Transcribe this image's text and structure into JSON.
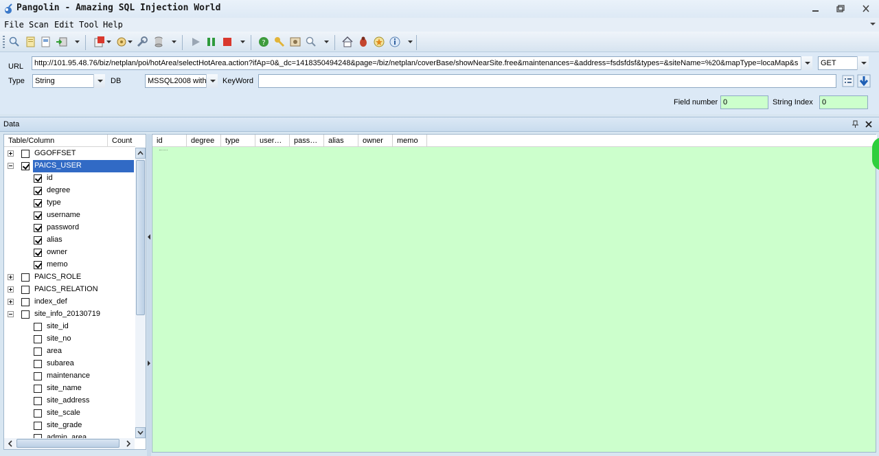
{
  "window": {
    "title": "Pangolin - Amazing SQL Injection World"
  },
  "menu": [
    "File",
    "Scan",
    "Edit",
    "Tool",
    "Help"
  ],
  "form": {
    "url_label": "URL",
    "url_value": "http://101.95.48.76/biz/netplan/poi/hotArea!selectHotArea.action?ifAp=0&_dc=1418350494248&page=/biz/netplan/coverBase/showNearSite.free&maintenances=&address=fsdsfdsf&types=&siteName=%20&mapType=locaMap&s",
    "method": "GET",
    "type_label": "Type",
    "type_value": "String",
    "db_label": "DB",
    "db_value": "MSSQL2008 with I",
    "keyword_label": "KeyWord",
    "keyword_value": "",
    "field_number_label": "Field number",
    "field_number_value": "0",
    "string_index_label": "String Index",
    "string_index_value": "0"
  },
  "panel": {
    "title": "Data"
  },
  "tree": {
    "col_table": "Table/Column",
    "col_count": "Count",
    "rows": [
      {
        "label": "GGOFFSET",
        "level": 0,
        "expander": "plus",
        "checked": false
      },
      {
        "label": "PAICS_USER",
        "level": 0,
        "expander": "minus",
        "checked": true,
        "selected": true
      },
      {
        "label": "id",
        "level": 1,
        "checked": true
      },
      {
        "label": "degree",
        "level": 1,
        "checked": true
      },
      {
        "label": "type",
        "level": 1,
        "checked": true
      },
      {
        "label": "username",
        "level": 1,
        "checked": true
      },
      {
        "label": "password",
        "level": 1,
        "checked": true
      },
      {
        "label": "alias",
        "level": 1,
        "checked": true
      },
      {
        "label": "owner",
        "level": 1,
        "checked": true
      },
      {
        "label": "memo",
        "level": 1,
        "checked": true
      },
      {
        "label": "PAICS_ROLE",
        "level": 0,
        "expander": "plus",
        "checked": false
      },
      {
        "label": "PAICS_RELATION",
        "level": 0,
        "expander": "plus",
        "checked": false
      },
      {
        "label": "index_def",
        "level": 0,
        "expander": "plus",
        "checked": false
      },
      {
        "label": "site_info_20130719",
        "level": 0,
        "expander": "minus",
        "checked": false
      },
      {
        "label": "site_id",
        "level": 1,
        "checked": false
      },
      {
        "label": "site_no",
        "level": 1,
        "checked": false
      },
      {
        "label": "area",
        "level": 1,
        "checked": false
      },
      {
        "label": "subarea",
        "level": 1,
        "checked": false
      },
      {
        "label": "maintenance",
        "level": 1,
        "checked": false
      },
      {
        "label": "site_name",
        "level": 1,
        "checked": false
      },
      {
        "label": "site_address",
        "level": 1,
        "checked": false
      },
      {
        "label": "site_scale",
        "level": 1,
        "checked": false
      },
      {
        "label": "site_grade",
        "level": 1,
        "checked": false
      },
      {
        "label": "admin_area",
        "level": 1,
        "checked": false
      }
    ]
  },
  "grid": {
    "columns": [
      "id",
      "degree",
      "type",
      "user…",
      "pass…",
      "alias",
      "owner",
      "memo"
    ]
  },
  "colors": {
    "grid_bg": "#ccffcc",
    "selection": "#316ac5",
    "accent_green": "#2ecf3d"
  },
  "icons": [
    "app-icon",
    "minimize-icon",
    "maximize-icon",
    "close-icon",
    "search-icon",
    "open-folder-icon",
    "save-icon",
    "export-icon",
    "stop-icon",
    "options-icon",
    "tools-icon",
    "database-icon",
    "play-icon",
    "pause-icon",
    "stop-square-icon",
    "help-icon",
    "key-icon",
    "settings-icon",
    "magnifier-icon",
    "home-icon",
    "bug-icon",
    "favorite-icon",
    "info-icon",
    "pin-icon",
    "panel-close-icon",
    "list-icon",
    "download-arrow-icon"
  ]
}
